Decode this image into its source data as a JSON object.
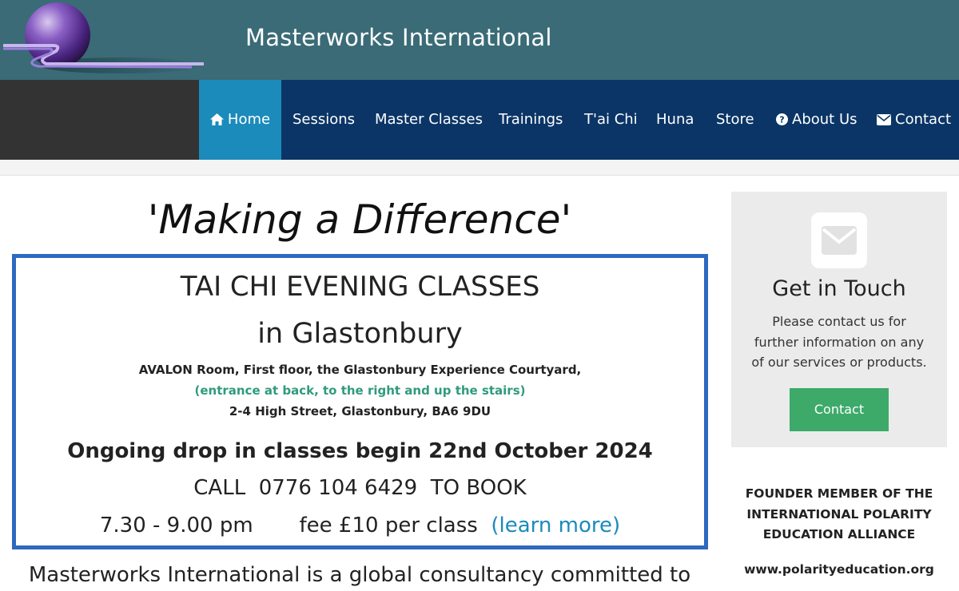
{
  "header": {
    "site_title": "Masterworks International",
    "logo_icon": "sphere-logo-icon"
  },
  "nav": {
    "items": [
      {
        "label": "Home",
        "icon": "home-icon",
        "active": true
      },
      {
        "label": "Sessions"
      },
      {
        "label": "Master Classes"
      },
      {
        "label": "Trainings"
      },
      {
        "label": "T'ai Chi"
      },
      {
        "label": "Huna"
      },
      {
        "label": "Store"
      },
      {
        "label": "About Us",
        "icon": "question-circle-icon"
      },
      {
        "label": "Contact",
        "icon": "envelope-icon"
      }
    ]
  },
  "main": {
    "headline": "'Making a Difference'",
    "class_box": {
      "title": "TAI CHI EVENING CLASSES",
      "subtitle": "in Glastonbury",
      "address": "AVALON Room, First floor, the Glastonbury Experience Courtyard,",
      "entrance_note": "(entrance at back, to the right and up the stairs)",
      "street": "2-4 High Street, Glastonbury, BA6 9DU",
      "ongoing": "Ongoing drop in classes begin 22nd October 2024",
      "call": "CALL  0776 104 6429  TO BOOK",
      "time": "7.30 - 9.00 pm",
      "fee": "fee £10 per class",
      "learn_more": "(learn more)"
    },
    "intro": "Masterworks International is a global consultancy committed to"
  },
  "sidebar": {
    "get_in_touch": {
      "title": "Get in Touch",
      "text": "Please contact us for further information on any of our services or products.",
      "button_label": "Contact"
    },
    "founder": "FOUNDER MEMBER OF THE INTERNATIONAL POLARITY EDUCATION ALLIANCE",
    "polarity_link": "www.polarityeducation.org"
  },
  "colors": {
    "header_bg": "#3a6b77",
    "nav_bg": "#0b3566",
    "nav_active": "#1b8bbb",
    "box_border": "#2e68c0",
    "accent_green": "#2f9b7c",
    "button_green": "#3daa6a"
  }
}
